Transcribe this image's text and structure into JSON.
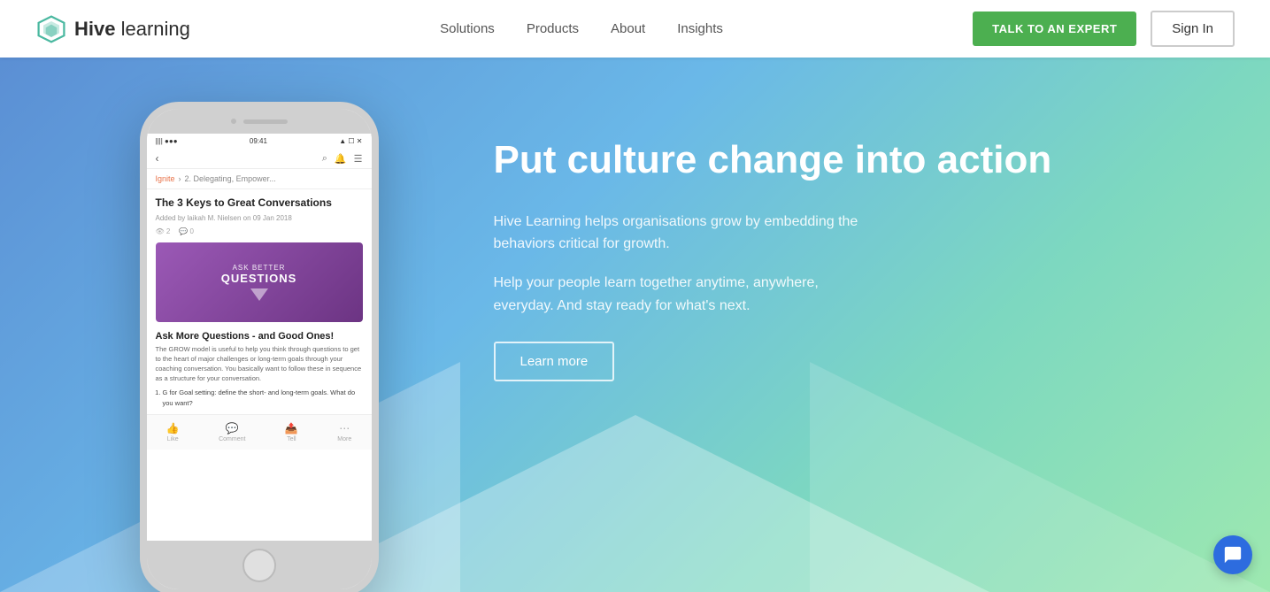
{
  "header": {
    "logo_hive": "Hive",
    "logo_learning": " learning",
    "nav": {
      "solutions": "Solutions",
      "products": "Products",
      "about": "About",
      "insights": "Insights"
    },
    "cta_talk": "TALK TO AN EXPERT",
    "cta_signin": "Sign In"
  },
  "hero": {
    "headline": "Put culture change into action",
    "description1": "Hive Learning helps organisations grow by embedding the behaviors critical for growth.",
    "description2": "Help your people learn together anytime, anywhere, everyday. And stay ready for what's next.",
    "learn_more": "Learn more"
  },
  "phone": {
    "status_left": "||||  ●●●",
    "status_time": "09:41",
    "status_right": "▲ ☐ ✕",
    "breadcrumb_part1": "Ignite",
    "breadcrumb_sep": "›",
    "breadcrumb_part2": "2. Delegating, Empower...",
    "article_title": "The 3 Keys to Great Conversations",
    "article_meta": "Added by laikah M. Nielsen on 09 Jan 2018",
    "stats_views": "👁 2",
    "stats_comments": "💬 0",
    "card_subtitle": "ASK BETTER",
    "card_title": "QUESTIONS",
    "content_title": "Ask More Questions - and Good Ones!",
    "content_text": "The GROW model is useful to help you think through questions to get to the heart of major challenges or long-term goals through your coaching conversation. You basically want to follow these in sequence as a structure for your conversation.",
    "list_item1": "G for Goal setting: define the short- and long-term goals. What do you want?",
    "bottom_like": "Like",
    "bottom_comment": "Comment",
    "bottom_tell": "Tell",
    "bottom_more": "More"
  }
}
